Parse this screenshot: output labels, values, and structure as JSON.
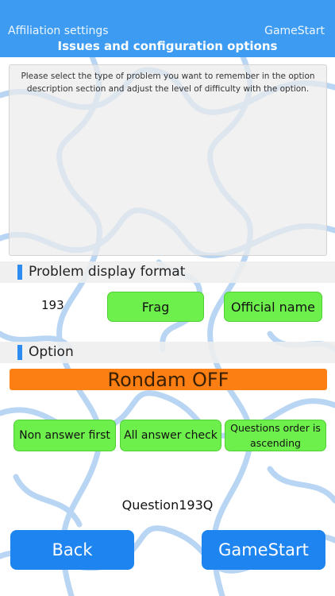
{
  "header": {
    "nav_left": "Affiliation settings",
    "nav_right": "GameStart",
    "title": "Issues and configuration options"
  },
  "description": {
    "text": "Please select the type of problem you want to remember in the option description section and adjust the level of difficulty with the option."
  },
  "display_format": {
    "section_label": "Problem display format",
    "count": "193",
    "buttons": {
      "frag": "Frag",
      "official": "Official name"
    }
  },
  "option": {
    "section_label": "Option",
    "random_toggle": "Rondam OFF",
    "buttons": {
      "non_answer": "Non answer first",
      "all_answer": "All answer check",
      "order": "Questions order is ascending"
    }
  },
  "question_label": "Question193Q",
  "footer": {
    "back": "Back",
    "gamestart": "GameStart"
  },
  "colors": {
    "header": "#3d9cf2",
    "green_button": "#6ef04c",
    "orange_bar": "#fb7f12",
    "blue_button": "#1e85f0",
    "puzzle_lines": "#b5d3f3"
  }
}
